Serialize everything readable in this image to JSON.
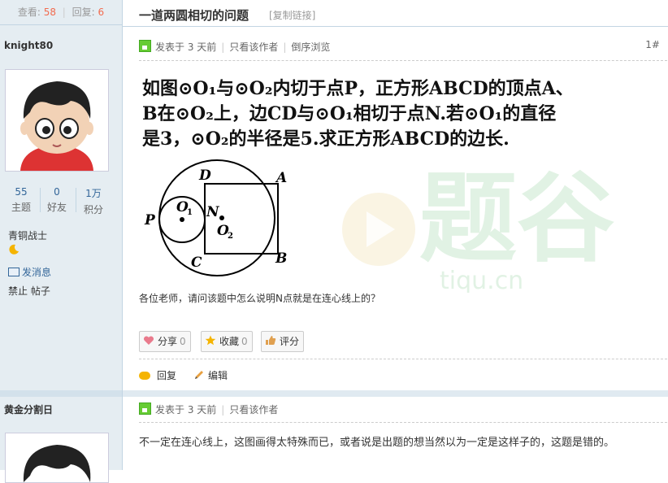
{
  "sidebar": {
    "views_label": "查看:",
    "views": "58",
    "replies_label": "回复:",
    "replies": "6",
    "author1": {
      "name": "knight80",
      "stats": [
        {
          "value": "55",
          "label": "主题"
        },
        {
          "value": "0",
          "label": "好友"
        },
        {
          "value": "1万",
          "label": "积分"
        }
      ],
      "rank": "青铜战士",
      "send_message": "发消息",
      "banned": "禁止 帖子"
    },
    "author2": {
      "name": "黄金分割日"
    }
  },
  "thread": {
    "title": "一道两圆相切的问题",
    "copy_link": "[复制链接]"
  },
  "post1": {
    "posted": "发表于 3 天前",
    "only_author": "只看该作者",
    "reverse": "倒序浏览",
    "floor": "1#",
    "problem_lines": [
      "如图⊙O₁与⊙O₂内切于点P，正方形ABCD的顶点A、",
      "B在⊙O₂上，边CD与⊙O₁相切于点N.若⊙O₁的直径",
      "是3，⊙O₂的半径是5.求正方形ABCD的边长."
    ],
    "figure_labels": {
      "D": "D",
      "A": "A",
      "P": "P",
      "O1": "O",
      "O1sub": "1",
      "N": "N",
      "O2": "O",
      "O2sub": "2",
      "C": "C",
      "B": "B"
    },
    "question": "各位老师，请问该题中怎么说明N点就是在连心线上的？",
    "buttons": {
      "share": "分享",
      "share_count": "0",
      "favorite": "收藏",
      "favorite_count": "0",
      "rate": "评分"
    },
    "reply": "回复",
    "edit": "编辑"
  },
  "post2": {
    "posted": "发表于 3 天前",
    "only_author": "只看该作者",
    "text": "不一定在连心线上，这图画得太特殊而已，或者说是出题的想当然以为一定是这样子的，这题是错的。"
  },
  "watermark": {
    "text": "题谷",
    "url": "tiqu.cn"
  },
  "colors": {
    "link": "#336699",
    "count_red": "#f26c4f",
    "sidebar_bg": "#e5edf2",
    "border": "#c2d5e3"
  }
}
